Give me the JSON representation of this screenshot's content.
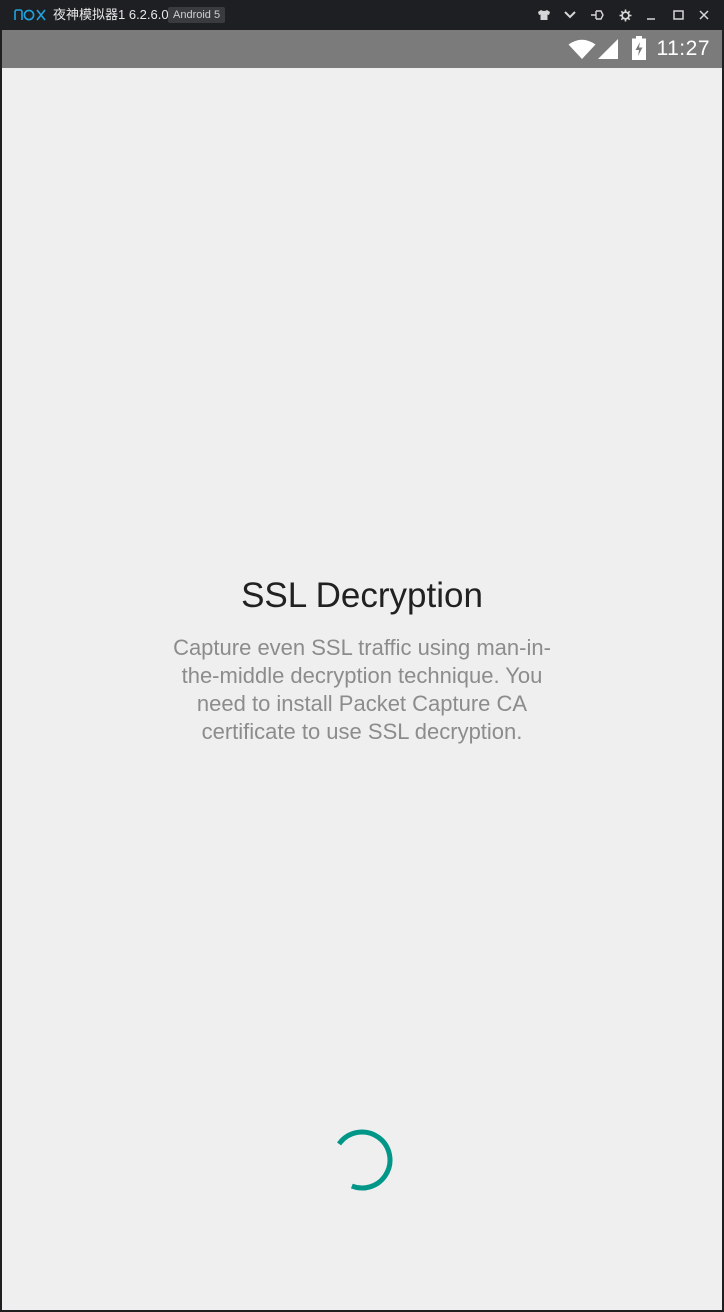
{
  "emulator": {
    "logo_text": "nox",
    "title": "夜神模拟器1 6.2.6.0",
    "badge": "Android 5",
    "controls": [
      "shirt-icon",
      "chevron-down-icon",
      "pin-icon",
      "gear-icon",
      "minimize-icon",
      "maximize-icon",
      "close-icon"
    ]
  },
  "statusbar": {
    "time": "11:27",
    "icons": [
      "wifi-icon",
      "cell-signal-icon",
      "battery-charging-icon"
    ]
  },
  "content": {
    "heading": "SSL Decryption",
    "description": "Capture even SSL traffic using man-in-\nthe-middle decryption technique.  You\nneed to install Packet Capture CA\ncertificate to use SSL decryption."
  },
  "colors": {
    "statusbar": "#7b7b7b",
    "background": "#efefef",
    "spinner": "#009688",
    "heading": "#212121",
    "description": "#8c8c8c",
    "brand": "#1fa3e0"
  }
}
